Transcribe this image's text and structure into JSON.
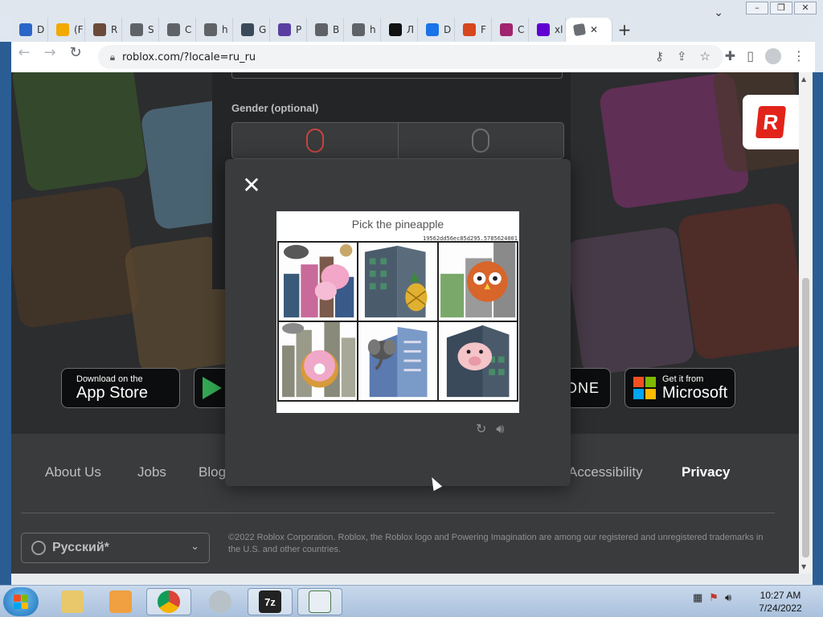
{
  "browser": {
    "tabs": [
      {
        "title": "D",
        "color": "#2a66c8"
      },
      {
        "title": "(F",
        "color": "#f2a900"
      },
      {
        "title": "R",
        "color": "#6b4a3a"
      },
      {
        "title": "S",
        "color": "#5f6368"
      },
      {
        "title": "C",
        "color": "#5f6368"
      },
      {
        "title": "h",
        "color": "#5f6368"
      },
      {
        "title": "G",
        "color": "#3a4a5a"
      },
      {
        "title": "P",
        "color": "#5a3fa0"
      },
      {
        "title": "B",
        "color": "#5f6368"
      },
      {
        "title": "h",
        "color": "#5f6368"
      },
      {
        "title": "Л",
        "color": "#111111"
      },
      {
        "title": "D",
        "color": "#1a73e8"
      },
      {
        "title": "F",
        "color": "#d7461e"
      },
      {
        "title": "C",
        "color": "#a0246e"
      },
      {
        "title": "xl",
        "color": "#6001d2"
      }
    ],
    "active_tab_close": "✕",
    "new_tab": "+",
    "url": "roblox.com/?locale=ru_ru",
    "window_buttons": [
      "–",
      "❐",
      "✕"
    ]
  },
  "signup": {
    "gender_label": "Gender (optional)"
  },
  "captcha": {
    "prompt": "Pick the pineapple",
    "challenge_id": "19562dd56ec85d295.5785624001",
    "tiles": [
      {
        "name": "butterfly"
      },
      {
        "name": "pineapple"
      },
      {
        "name": "owl"
      },
      {
        "name": "donut"
      },
      {
        "name": "elephant"
      },
      {
        "name": "pig"
      }
    ]
  },
  "stores": {
    "apple_small": "Download on the",
    "apple_big": "App Store",
    "xbox_text": "ONE",
    "ms_small": "Get it from",
    "ms_big": "Microsoft"
  },
  "footer": {
    "links": [
      "About Us",
      "Jobs",
      "Blog",
      "Accessibility",
      "Privacy"
    ],
    "language": "Русский*",
    "copyright": "©2022 Roblox Corporation. Roblox, the Roblox logo and Powering Imagination are among our registered and unregistered trademarks in the U.S. and other countries."
  },
  "taskbar": {
    "time": "10:27 AM",
    "date": "7/24/2022",
    "apps": [
      "7z"
    ]
  }
}
